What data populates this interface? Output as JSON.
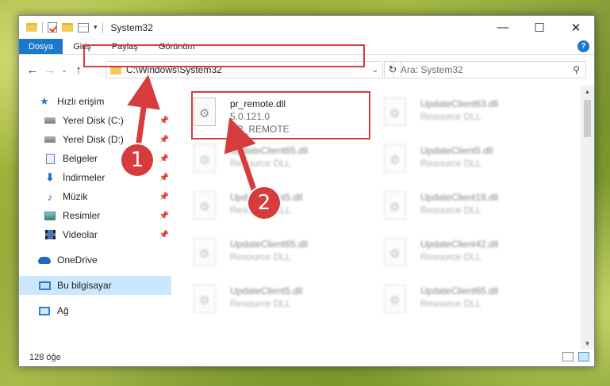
{
  "window": {
    "title": "System32",
    "min": "—",
    "max": "☐",
    "close": "✕"
  },
  "ribbon": {
    "tabs": [
      "Dosya",
      "Giriş",
      "Paylaş",
      "Görünüm"
    ],
    "help": "?"
  },
  "nav": {
    "back": "←",
    "forward": "→",
    "recent": "⌄",
    "up": "↑",
    "address": "C:\\Windows\\System32",
    "address_dropdown": "⌄",
    "refresh": "↻",
    "search_placeholder": "Ara: System32",
    "search_icon": "⚲"
  },
  "sidebar": {
    "quick_access": "Hızlı erişim",
    "items": [
      {
        "label": "Yerel Disk (C:)",
        "icon": "disk-icon",
        "pinned": true
      },
      {
        "label": "Yerel Disk (D:)",
        "icon": "disk-icon",
        "pinned": true
      },
      {
        "label": "Belgeler",
        "icon": "documents-icon",
        "pinned": true
      },
      {
        "label": "İndirmeler",
        "icon": "downloads-icon",
        "pinned": true
      },
      {
        "label": "Müzik",
        "icon": "music-icon",
        "pinned": true
      },
      {
        "label": "Resimler",
        "icon": "pictures-icon",
        "pinned": true
      },
      {
        "label": "Videolar",
        "icon": "videos-icon",
        "pinned": true
      }
    ],
    "onedrive": "OneDrive",
    "this_pc": "Bu bilgisayar",
    "network": "Ağ"
  },
  "files": {
    "highlighted": {
      "name": "pr_remote.dll",
      "version": "5.0.121.0",
      "desc": "PR_REMOTE"
    },
    "items": [
      {
        "name": "UpdateClient63.dll",
        "desc": "Resource DLL"
      },
      {
        "name": "UpdateClient65.dll",
        "desc": "Resource DLL"
      },
      {
        "name": "UpdateClient5.dll",
        "desc": "Resource DLL"
      },
      {
        "name": "UpdateClient5.dll",
        "desc": "Resource DLL"
      },
      {
        "name": "UpdateClient19.dll",
        "desc": "Resource DLL"
      },
      {
        "name": "UpdateClient65.dll",
        "desc": "Resource DLL"
      },
      {
        "name": "UpdateClient42.dll",
        "desc": "Resource DLL"
      },
      {
        "name": "UpdateClient5.dll",
        "desc": "Resource DLL"
      },
      {
        "name": "UpdateClient65.dll",
        "desc": "Resource DLL"
      }
    ]
  },
  "status": {
    "count": "128 öğe"
  },
  "annotations": {
    "step1": "1",
    "step2": "2",
    "color": "#d63c3c"
  }
}
